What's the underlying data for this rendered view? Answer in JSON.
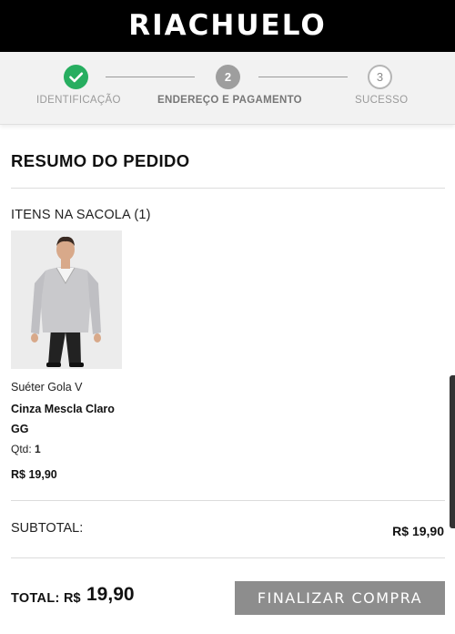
{
  "header": {
    "brand": "RIACHUELO"
  },
  "steps": [
    {
      "label": "IDENTIFICAÇÃO",
      "state": "done",
      "icon": "check-icon"
    },
    {
      "number": "2",
      "label": "ENDEREÇO E PAGAMENTO",
      "state": "current"
    },
    {
      "number": "3",
      "label": "SUCESSO",
      "state": "pending"
    }
  ],
  "summary": {
    "title": "RESUMO DO PEDIDO",
    "bag_header": "ITENS NA SACOLA (1)",
    "item": {
      "name": "Suéter Gola V",
      "color": "Cinza Mescla Claro",
      "size": "GG",
      "qty_label": "Qtd:",
      "qty": "1",
      "price": "R$ 19,90"
    },
    "subtotal_label": "SUBTOTAL:",
    "subtotal_value": "R$ 19,90",
    "total_label": "TOTAL:",
    "total_currency": "R$",
    "total_value": "19,90",
    "finalize_label": "FINALIZAR COMPRA"
  },
  "colors": {
    "success": "#27ae60",
    "step_current": "#9e9e9e",
    "button": "#8d8d8d"
  }
}
